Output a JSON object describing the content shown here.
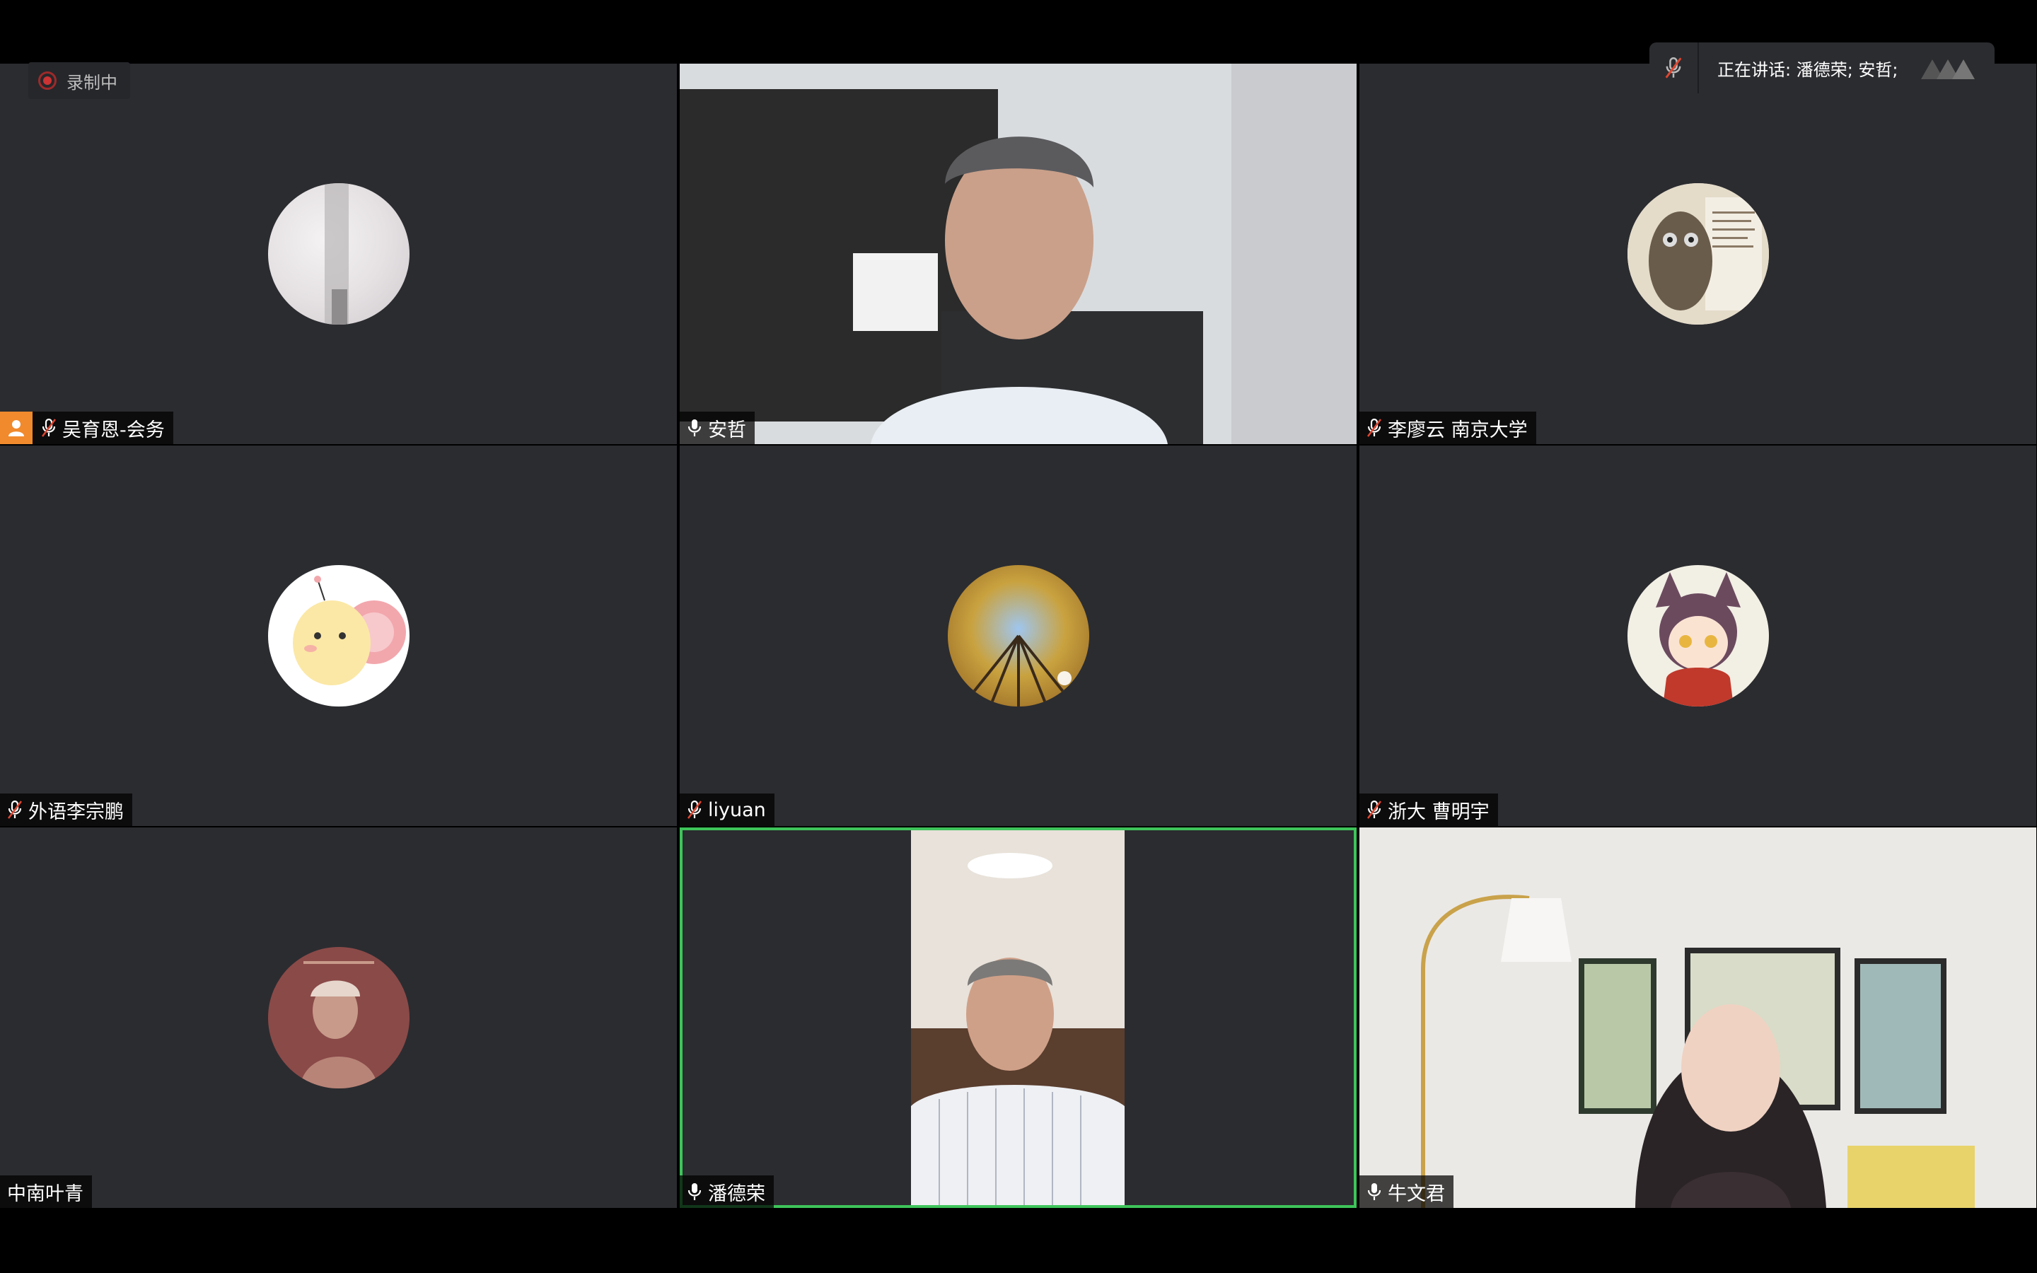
{
  "recording": {
    "label": "录制中"
  },
  "speaker_panel": {
    "label": "正在讲话: 潘德荣; 安哲;"
  },
  "tiles": [
    {
      "name": "吴育恩-会务"
    },
    {
      "name": "安哲"
    },
    {
      "name": "李廖云 南京大学"
    },
    {
      "name": "外语李宗鹏"
    },
    {
      "name": "liyuan"
    },
    {
      "name": "浙大 曹明宇"
    },
    {
      "name": "中南叶青"
    },
    {
      "name": "潘德荣"
    },
    {
      "name": "牛文君"
    }
  ],
  "colors": {
    "tile_bg": "#2b2c30",
    "active_speaker_border": "#3ec45a",
    "host_badge": "#f08a2d",
    "recording_dot": "#cc3333"
  },
  "icons": [
    "record-icon",
    "microphone-icon",
    "microphone-muted-icon",
    "host-icon",
    "app-logo-icon"
  ]
}
